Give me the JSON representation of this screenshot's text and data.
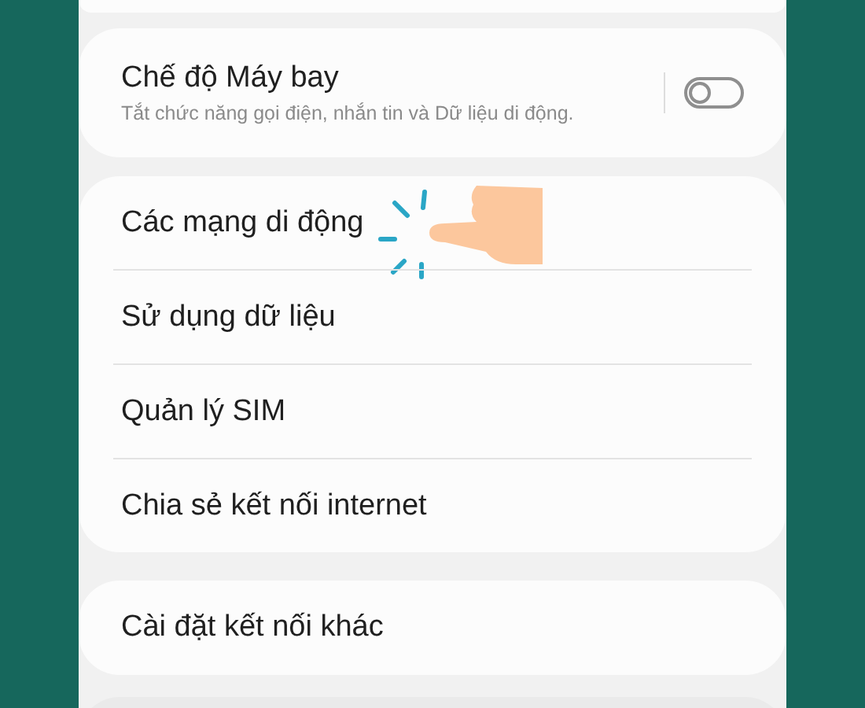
{
  "airplane_mode": {
    "title": "Chế độ Máy bay",
    "subtitle": "Tắt chức năng gọi điện, nhắn tin và Dữ liệu di động.",
    "on": false
  },
  "connection_items": [
    {
      "label": "Các mạng di động",
      "tapped": true
    },
    {
      "label": "Sử dụng dữ liệu",
      "tapped": false
    },
    {
      "label": "Quản lý SIM",
      "tapped": false
    },
    {
      "label": "Chia sẻ kết nối internet",
      "tapped": false
    }
  ],
  "more_settings": {
    "label": "Cài đặt kết nối khác"
  }
}
